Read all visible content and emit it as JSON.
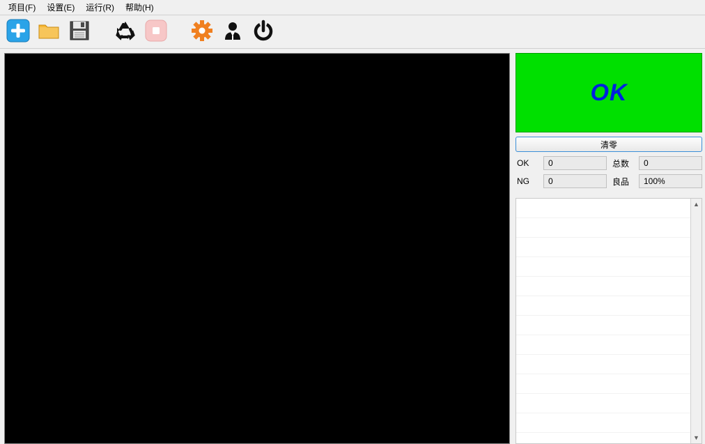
{
  "menu": {
    "project": "项目(F)",
    "settings": "设置(E)",
    "run": "运行(R)",
    "help": "帮助(H)"
  },
  "status": {
    "text": "OK",
    "bg": "#00e000",
    "fg": "#0020e0"
  },
  "buttons": {
    "clear": "清零"
  },
  "stats": {
    "ok_label": "OK",
    "ok_value": "0",
    "ng_label": "NG",
    "ng_value": "0",
    "total_label": "总数",
    "total_value": "0",
    "yield_label": "良品",
    "yield_value": "100%"
  }
}
